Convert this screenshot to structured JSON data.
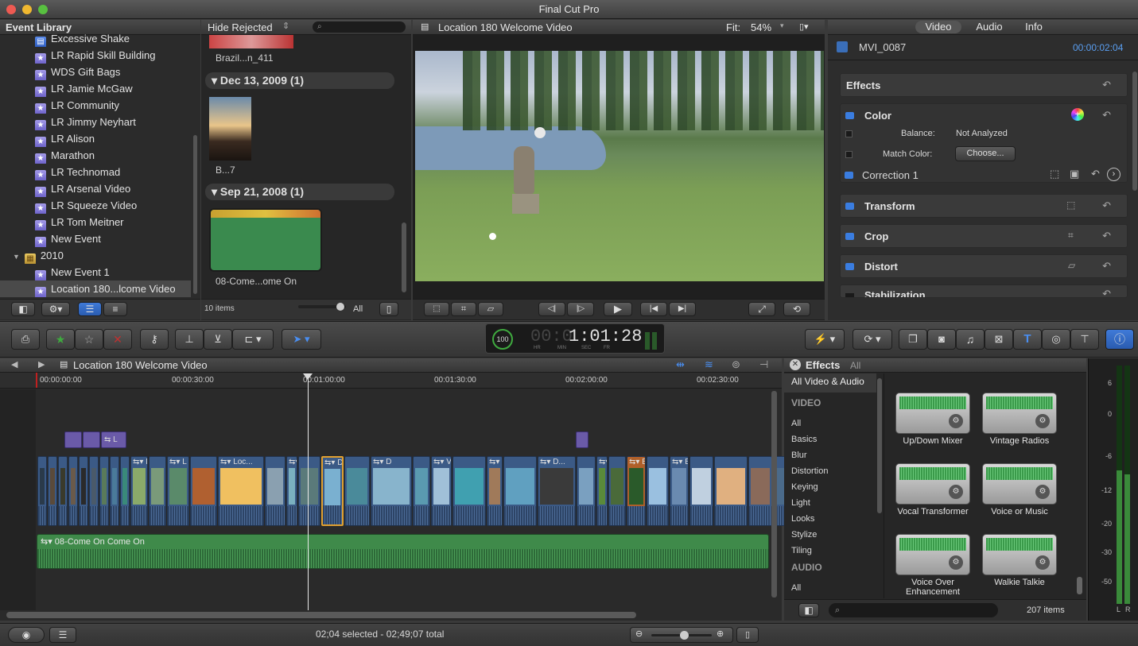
{
  "app": {
    "title": "Final Cut Pro"
  },
  "colors": {
    "accent": "#3a7de0",
    "event_star": "#8a7ee0",
    "audio_green": "#3f8a4a",
    "selection": "#e0a030"
  },
  "event_library": {
    "title": "Event Library",
    "items": [
      {
        "label": "Excessive Shake"
      },
      {
        "label": "LR Rapid Skill Building"
      },
      {
        "label": "WDS Gift Bags"
      },
      {
        "label": "LR Jamie McGaw"
      },
      {
        "label": "LR Community"
      },
      {
        "label": "LR Jimmy Neyhart"
      },
      {
        "label": "LR Alison"
      },
      {
        "label": "Marathon"
      },
      {
        "label": "LR Technomad"
      },
      {
        "label": "LR Arsenal Video"
      },
      {
        "label": "LR Squeeze Video"
      },
      {
        "label": "LR Tom Meitner"
      },
      {
        "label": "New Event"
      }
    ],
    "year": "2010",
    "year_items": [
      {
        "label": "New Event 1"
      },
      {
        "label": "Location 180...lcome Video"
      }
    ]
  },
  "browser": {
    "filter": "Hide Rejected",
    "clip1_label": "Brazil...n_411",
    "group1": "Dec 13, 2009  (1)",
    "clip2_label": "B...7",
    "group2": "Sep 21, 2008  (1)",
    "clip3_label": "08-Come...ome On",
    "count": "10 items",
    "all": "All"
  },
  "viewer": {
    "title": "Location 180 Welcome Video",
    "fit_label": "Fit:",
    "zoom": "54%"
  },
  "inspector": {
    "tabs": [
      "Video",
      "Audio",
      "Info"
    ],
    "clip_name": "MVI_0087",
    "timecode": "00:00:02:04",
    "effects": "Effects",
    "color": "Color",
    "balance_label": "Balance:",
    "balance_value": "Not Analyzed",
    "match_color_label": "Match Color:",
    "choose": "Choose...",
    "correction": "Correction 1",
    "transform": "Transform",
    "crop": "Crop",
    "distort": "Distort",
    "stabilization": "Stabilization"
  },
  "toolbar": {
    "timecode": "1:01:28",
    "timecode_dim": "00:0",
    "tc_labels": [
      "HR",
      "MIN",
      "SEC",
      "FR"
    ],
    "percent": "100"
  },
  "timeline": {
    "title": "Location 180 Welcome Video",
    "ruler": [
      "00:00:00:00",
      "00:00:30:00",
      "00:01:00:00",
      "00:01:30:00",
      "00:02:00:00",
      "00:02:30:00"
    ],
    "audio_clip": "08-Come On Come On",
    "clip_titles": [
      "M",
      "L",
      "Loc...",
      "",
      "D",
      "D",
      "Vi...",
      "D",
      "D...",
      "Vi...",
      "B...",
      "B"
    ]
  },
  "effects_browser": {
    "title": "Effects",
    "all_tab": "All",
    "selected": "All Video & Audio",
    "video_header": "VIDEO",
    "video_cats": [
      "All",
      "Basics",
      "Blur",
      "Distortion",
      "Keying",
      "Light",
      "Looks",
      "Stylize",
      "Tiling"
    ],
    "audio_header": "AUDIO",
    "audio_cats": [
      "All"
    ],
    "items": [
      "Up/Down Mixer",
      "Vintage Radios",
      "Vocal Transformer",
      "Voice or Music",
      "Voice Over Enhancement",
      "Walkie Talkie"
    ],
    "count": "207 items"
  },
  "meters": {
    "ticks": [
      "6",
      "0",
      "-6",
      "-12",
      "-20",
      "-30",
      "-50"
    ],
    "l": "L",
    "r": "R"
  },
  "status": {
    "text": "02;04 selected - 02;49;07 total"
  }
}
